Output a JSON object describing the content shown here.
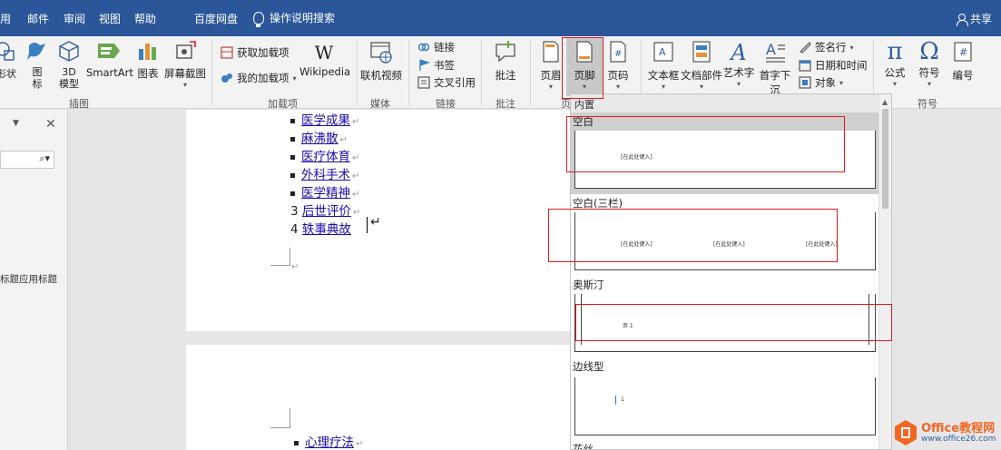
{
  "tabs": {
    "t1": "用",
    "t2": "邮件",
    "t3": "审阅",
    "t4": "视图",
    "t5": "帮助",
    "t6": "百度网盘",
    "tell": "操作说明搜索",
    "share": "共享"
  },
  "ribbon": {
    "shape": "形状",
    "icon_label": "图标",
    "model3d": "3D 模型",
    "smartart": "SmartArt",
    "chart": "图表",
    "screenshot": "屏幕截图",
    "group_illus": "插图",
    "get_addins": "获取加载项",
    "my_addins": "我的加载项",
    "wikipedia": "Wikipedia",
    "group_addins": "加载项",
    "online_video": "联机视频",
    "group_media": "媒体",
    "link": "链接",
    "bookmark": "书签",
    "crossref": "交叉引用",
    "group_links": "链接",
    "comment": "批注",
    "group_comments": "批注",
    "header": "页眉",
    "footer": "页脚",
    "page_num": "页码",
    "group_hf": "页",
    "textbox": "文本框",
    "quickparts": "文档部件",
    "wordart": "艺术字",
    "dropcap": "首字下沉",
    "signature": "签名行",
    "datetime": "日期和时间",
    "object": "对象",
    "equation": "公式",
    "symbol": "符号",
    "number": "编号",
    "group_symbols": "符号"
  },
  "leftpane": {
    "heading_hint": "标题应用标题"
  },
  "document": {
    "items": [
      {
        "prefix": "",
        "text": "医学成果"
      },
      {
        "prefix": "",
        "text": "麻沸散"
      },
      {
        "prefix": "",
        "text": "医疗体育"
      },
      {
        "prefix": "",
        "text": "外科手术"
      },
      {
        "prefix": "",
        "text": "医学精神"
      },
      {
        "prefix": "3",
        "text": "后世评价"
      },
      {
        "prefix": "4",
        "text": "轶事典故"
      }
    ],
    "page2_item": "心理疗法"
  },
  "gallery": {
    "section": "内置",
    "styles": [
      {
        "name": "空白",
        "placeholder": "[在此处键入]"
      },
      {
        "name": "空白(三栏)",
        "placeholder": "[在此处键入]"
      },
      {
        "name": "奥斯汀",
        "placeholder": "页 1"
      },
      {
        "name": "边线型",
        "placeholder": "1"
      },
      {
        "name": "花丝"
      }
    ]
  },
  "logo": {
    "brand": "Office教程网",
    "url": "www.office26.com"
  },
  "colors": {
    "ribbon_blue": "#2b579a",
    "highlight_red": "#e0191f",
    "link_blue": "#1a0dab"
  }
}
